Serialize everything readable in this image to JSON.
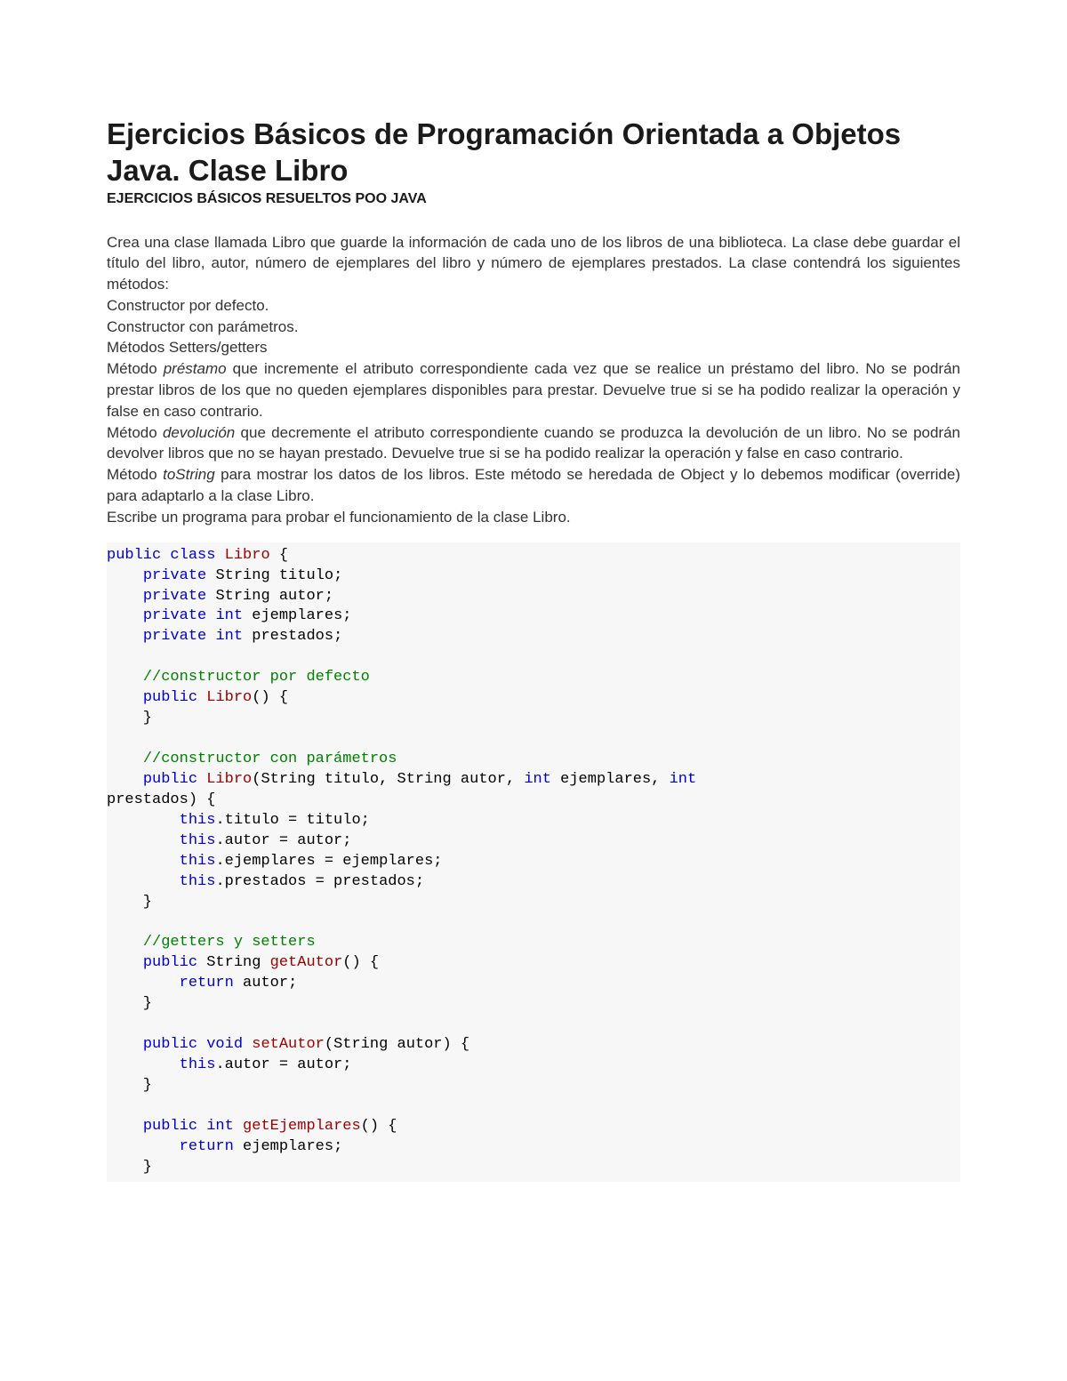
{
  "title": "Ejercicios Básicos de Programación Orientada a Objetos Java. Clase Libro",
  "subtitle": "EJERCICIOS BÁSICOS RESUELTOS POO JAVA",
  "intro": {
    "p1": "Crea una clase llamada Libro que guarde la información de cada uno de los libros de una biblioteca. La clase debe guardar el título del libro, autor, número de ejemplares del libro y número de ejemplares prestados. La clase contendrá los siguientes métodos:",
    "l1": "Constructor por defecto.",
    "l2": "Constructor con parámetros.",
    "l3": "Métodos Setters/getters",
    "m1_pre": "Método",
    "m1_em": " préstamo ",
    "m1_post": "que incremente el atributo correspondiente cada vez que se realice un préstamo del libro. No se podrán prestar libros de los que no queden ejemplares disponibles para prestar. Devuelve true si se ha podido realizar la operación y false en caso contrario.",
    "m2_pre": "Método",
    "m2_em": " devolución ",
    "m2_post": "que decremente el atributo correspondiente cuando se produzca la devolución de un libro. No se podrán devolver libros que no se hayan prestado. Devuelve true si se ha podido realizar la operación y false en caso contrario.",
    "m3_pre": "Método",
    "m3_em": " toString ",
    "m3_post": "para mostrar los datos de los libros. Este método se heredada de Object y lo debemos modificar (override) para adaptarlo a la clase Libro.",
    "final": "Escribe un programa para probar el funcionamiento de la clase Libro."
  },
  "code": {
    "kw_public": "public",
    "kw_class": "class",
    "kw_private": "private",
    "kw_int": "int",
    "kw_this": "this",
    "kw_return": "return",
    "kw_void": "void",
    "cls_Libro": "Libro",
    "t_String": "String",
    "id_titulo": "titulo",
    "id_autor": "autor",
    "id_ejemplares": "ejemplares",
    "id_prestados": "prestados",
    "cmt_defecto": "//constructor por defecto",
    "cmt_param": "//constructor con parámetros",
    "cmt_gs": "//getters y setters",
    "mth_getAutor": "getAutor",
    "mth_setAutor": "setAutor",
    "mth_getEjemplares": "getEjemplares",
    "assign_titulo": ".titulo = titulo;",
    "assign_autor": ".autor = autor;",
    "assign_ejemplares": ".ejemplares = ejemplares;",
    "assign_prestados": ".prestados = prestados;"
  }
}
